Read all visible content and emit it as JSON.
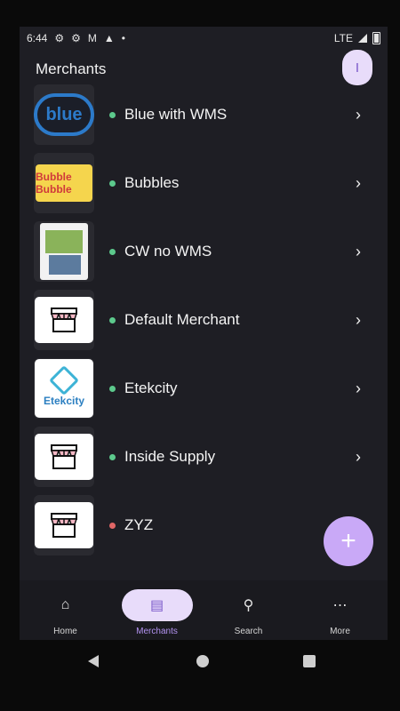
{
  "status_bar": {
    "time": "6:44",
    "network": "LTE"
  },
  "header": {
    "title": "Merchants",
    "avatar_initial": "I"
  },
  "merchants": [
    {
      "name": "Blue with WMS",
      "status_color": "#5cc98c",
      "logo": "blue-logo"
    },
    {
      "name": "Bubbles",
      "status_color": "#5cc98c",
      "logo": "bubbles-logo"
    },
    {
      "name": "CW no WMS",
      "status_color": "#5cc98c",
      "logo": "cw-logo"
    },
    {
      "name": "Default Merchant",
      "status_color": "#5cc98c",
      "logo": "store-icon"
    },
    {
      "name": "Etekcity",
      "status_color": "#5cc98c",
      "logo": "etekcity-logo"
    },
    {
      "name": "Inside Supply",
      "status_color": "#5cc98c",
      "logo": "store-icon"
    },
    {
      "name": "ZYZ",
      "status_color": "#e06666",
      "logo": "store-icon"
    }
  ],
  "logo_text": {
    "blue": "blue",
    "bubbles": "Bubble Bubble",
    "etekcity": "Etekcity"
  },
  "fab": {
    "icon": "plus-icon",
    "symbol": "+"
  },
  "bottom_nav": [
    {
      "label": "Home",
      "icon": "home-icon",
      "active": false
    },
    {
      "label": "Merchants",
      "icon": "store-icon",
      "active": true
    },
    {
      "label": "Search",
      "icon": "search-icon",
      "active": false
    },
    {
      "label": "More",
      "icon": "more-icon",
      "active": false
    }
  ],
  "colors": {
    "accent": "#c9a9f7",
    "accent_dark": "#7a58c9",
    "background": "#1e1e24",
    "active_status": "#5cc98c",
    "inactive_status": "#e06666"
  }
}
